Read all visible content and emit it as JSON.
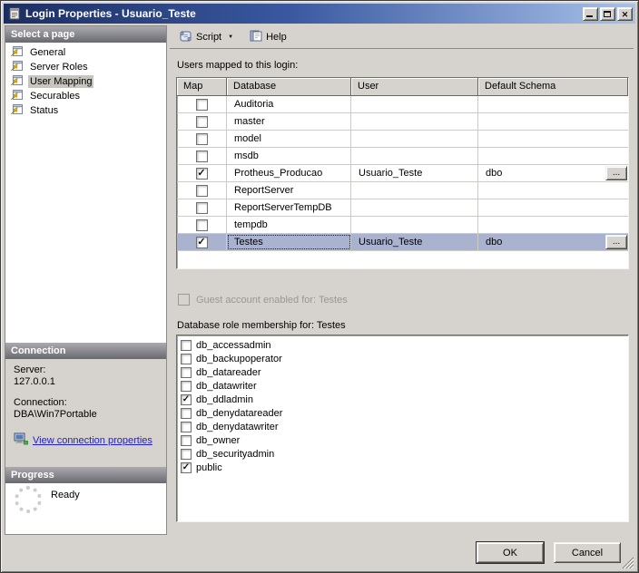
{
  "window": {
    "title": "Login Properties - Usuario_Teste"
  },
  "icons": {
    "check_glyph": "✓",
    "close_glyph": "✕",
    "dropdown_glyph": "▼"
  },
  "colors": {
    "titlebar_start": "#1b2e63",
    "titlebar_end": "#a7c2e9",
    "dialog_bg": "#d6d3ce",
    "row_selection": "#a9b3cf",
    "sidebar_selection": "#c8c5bf",
    "link": "#2121cc"
  },
  "sidebar": {
    "select_page_header": "Select a page",
    "pages": [
      {
        "label": "General",
        "selected": false
      },
      {
        "label": "Server Roles",
        "selected": false
      },
      {
        "label": "User Mapping",
        "selected": true
      },
      {
        "label": "Securables",
        "selected": false
      },
      {
        "label": "Status",
        "selected": false
      }
    ],
    "connection_header": "Connection",
    "connection": {
      "server_label": "Server:",
      "server_value": "127.0.0.1",
      "connection_label": "Connection:",
      "connection_value": "DBA\\Win7Portable",
      "link_label": "View connection properties"
    },
    "progress_header": "Progress",
    "progress_status": "Ready"
  },
  "toolbar": {
    "script_label": "Script",
    "help_label": "Help"
  },
  "main": {
    "users_mapped_label": "Users mapped to this login:",
    "table": {
      "columns": [
        "Map",
        "Database",
        "User",
        "Default Schema"
      ],
      "browse_button_label": "...",
      "rows": [
        {
          "mapped": false,
          "database": "Auditoria",
          "user": "",
          "default_schema": "",
          "selected": false
        },
        {
          "mapped": false,
          "database": "master",
          "user": "",
          "default_schema": "",
          "selected": false
        },
        {
          "mapped": false,
          "database": "model",
          "user": "",
          "default_schema": "",
          "selected": false
        },
        {
          "mapped": false,
          "database": "msdb",
          "user": "",
          "default_schema": "",
          "selected": false
        },
        {
          "mapped": true,
          "database": "Protheus_Producao",
          "user": "Usuario_Teste",
          "default_schema": "dbo",
          "selected": false
        },
        {
          "mapped": false,
          "database": "ReportServer",
          "user": "",
          "default_schema": "",
          "selected": false
        },
        {
          "mapped": false,
          "database": "ReportServerTempDB",
          "user": "",
          "default_schema": "",
          "selected": false
        },
        {
          "mapped": false,
          "database": "tempdb",
          "user": "",
          "default_schema": "",
          "selected": false
        },
        {
          "mapped": true,
          "database": "Testes",
          "user": "Usuario_Teste",
          "default_schema": "dbo",
          "selected": true
        }
      ]
    },
    "guest_checkbox_label": "Guest account enabled for: Testes",
    "role_membership_label": "Database role membership for: Testes",
    "roles": [
      {
        "name": "db_accessadmin",
        "checked": false
      },
      {
        "name": "db_backupoperator",
        "checked": false
      },
      {
        "name": "db_datareader",
        "checked": false
      },
      {
        "name": "db_datawriter",
        "checked": false
      },
      {
        "name": "db_ddladmin",
        "checked": true
      },
      {
        "name": "db_denydatareader",
        "checked": false
      },
      {
        "name": "db_denydatawriter",
        "checked": false
      },
      {
        "name": "db_owner",
        "checked": false
      },
      {
        "name": "db_securityadmin",
        "checked": false
      },
      {
        "name": "public",
        "checked": true
      }
    ]
  },
  "footer": {
    "ok_label": "OK",
    "cancel_label": "Cancel"
  }
}
